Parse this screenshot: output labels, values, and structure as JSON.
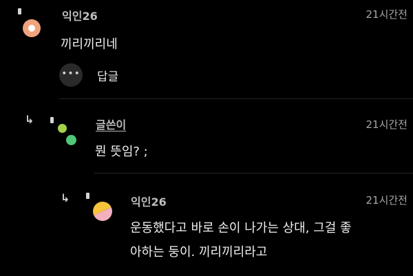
{
  "comments": [
    {
      "author": "익인26",
      "time": "21시간전",
      "text": "끼리끼리네",
      "more_label": "•••",
      "reply_label": "답글",
      "avatar_color": "#f0a37c"
    },
    {
      "author": "글쓴이",
      "time": "21시간전",
      "text": "뭔 뜻임? ;",
      "reply_arrow": "↳",
      "avatar_colors": [
        "#a5d24a",
        "#4fc779"
      ]
    },
    {
      "author": "익인26",
      "time": "21시간전",
      "text_line1": "운동했다고 바로 손이 나가는 상대, 그걸 좋",
      "text_line2": "아하는 둥이. 끼리끼리라고",
      "reply_arrow": "↳",
      "avatar_colors": [
        "#f6c33a",
        "#f3b1bf"
      ]
    }
  ]
}
